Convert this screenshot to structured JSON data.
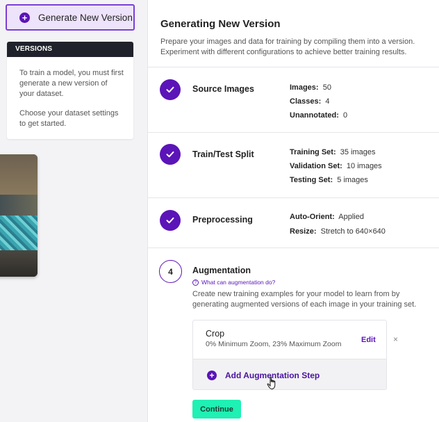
{
  "sidebar": {
    "generate_button_label": "Generate New Version",
    "versions_header": "VERSIONS",
    "versions_text_1": "To train a model, you must first generate a new version of your dataset.",
    "versions_text_2": "Choose your dataset settings to get started."
  },
  "main": {
    "title": "Generating New Version",
    "description": "Prepare your images and data for training by compiling them into a version. Experiment with different configurations to achieve better training results.",
    "steps": [
      {
        "title": "Source Images",
        "status": "completed",
        "info": [
          {
            "label": "Images:",
            "value": "50"
          },
          {
            "label": "Classes:",
            "value": "4"
          },
          {
            "label": "Unannotated:",
            "value": "0"
          }
        ]
      },
      {
        "title": "Train/Test Split",
        "status": "completed",
        "info": [
          {
            "label": "Training Set:",
            "value": "35 images"
          },
          {
            "label": "Validation Set:",
            "value": "10 images"
          },
          {
            "label": "Testing Set:",
            "value": "5 images"
          }
        ]
      },
      {
        "title": "Preprocessing",
        "status": "completed",
        "info": [
          {
            "label": "Auto-Orient:",
            "value": "Applied"
          },
          {
            "label": "Resize:",
            "value": "Stretch to 640×640"
          }
        ]
      },
      {
        "number": "4",
        "title": "Augmentation",
        "status": "active",
        "help_link": "What can augmentation do?",
        "description": "Create new training examples for your model to learn from by generating augmented versions of each image in your training set.",
        "augmentation": {
          "name": "Crop",
          "detail": "0% Minimum Zoom, 23% Maximum Zoom",
          "edit_label": "Edit",
          "remove_label": "×",
          "add_label": "Add Augmentation Step"
        },
        "continue_label": "Continue"
      }
    ]
  },
  "colors": {
    "accent": "#5b14b8",
    "continue": "#1ff0b3",
    "versions_header_bg": "#1f222b"
  }
}
